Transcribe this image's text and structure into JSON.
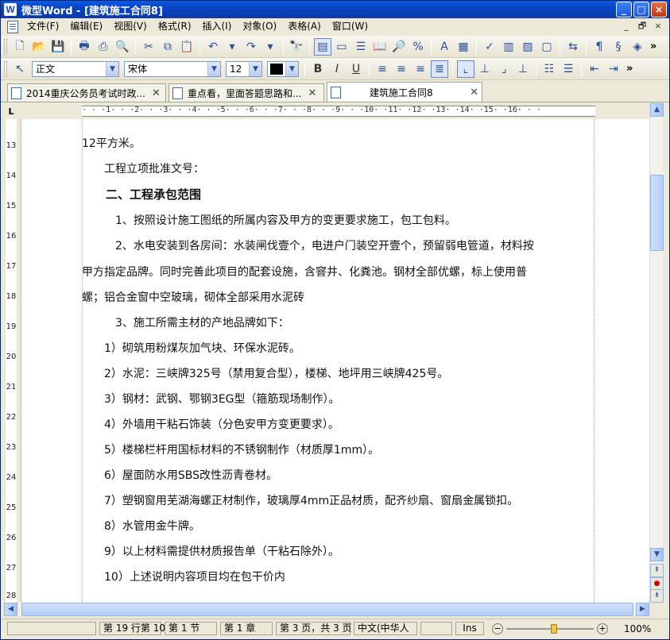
{
  "app": {
    "icon_letter": "W",
    "title": "微型Word - [建筑施工合同8]",
    "window_buttons": [
      "_",
      "□",
      "×"
    ]
  },
  "menubar": {
    "items": [
      "文件(F)",
      "编辑(E)",
      "视图(V)",
      "格式(R)",
      "插入(I)",
      "对象(O)",
      "表格(A)",
      "窗口(W)"
    ],
    "right_buttons": [
      "_",
      "🗗",
      "×"
    ]
  },
  "toolbar2": {
    "style_value": "正文",
    "font_value": "宋体",
    "size_value": "12"
  },
  "tabs": [
    {
      "label": "2014重庆公务员考试时政..."
    },
    {
      "label": "重点看，里面答题思路和..."
    },
    {
      "label": "建筑施工合同8"
    }
  ],
  "ruler": {
    "corner": "L",
    "h_marks": "· · ·1· · ·2· · ·3· · ·4· · ·5· · ·6· · ·7· · ·8· · ·9· · ·10· ·11· ·12· ·13· ·14· ·15· ·16· · ·",
    "v_marks": [
      "13",
      "14",
      "15",
      "16",
      "17",
      "18",
      "19",
      "20",
      "21",
      "22",
      "23",
      "24",
      "25",
      "26",
      "27",
      "28"
    ]
  },
  "document": {
    "lines": [
      "12平方米。",
      "　　工程立项批准文号：",
      "　　二、工程承包范围",
      "　　　1、按照设计施工图纸的所属内容及甲方的变更要求施工，包工包料。",
      "　　　2、水电安装到各房间：水装闸伐壹个，电进户门装空开壹个，预留弱电管道，材料按",
      "甲方指定品牌。同时完善此项目的配套设施，含窨井、化粪池。钢材全部优螺，标上使用普",
      "螺；铝合金窗中空玻璃，砌体全部采用水泥砖",
      "　　　3、施工所需主材的产地品牌如下：",
      "　　1）砌筑用粉煤灰加气块、环保水泥砖。",
      "　　2）水泥：三峡牌325号（禁用复合型），楼梯、地坪用三峡牌425号。",
      "　　3）钢材：武钢、鄂钢3EG型（箍筋现场制作）。",
      "　　4）外墙用干粘石饰装（分色安甲方变更要求）。",
      "　　5）楼梯栏杆用国标材料的不锈钢制作（材质厚1mm）。",
      "　　6）屋面防水用SBS改性沥青卷材。",
      "　　7）塑钢窗用芜湖海螺正材制作，玻璃厚4mm正品材质，配齐纱扇、窗扇金属锁扣。",
      "　　8）水管用金牛牌。",
      "　　9）以上材料需提供材质报告单（干粘石除外）。",
      "　　10）上述说明内容项目均在包干价内"
    ]
  },
  "statusbar": {
    "row_col": "第 19 行第 10",
    "section": "第 1 节",
    "chapter": "第 1 章",
    "page": "第 3 页，共 3 页",
    "language": "中文(中华人",
    "ins": "Ins",
    "zoom": "100%"
  }
}
